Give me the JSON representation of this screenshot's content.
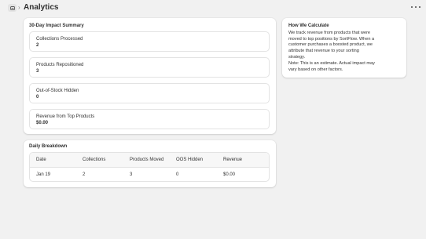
{
  "header": {
    "title": "Analytics",
    "breadcrumb_separator": "›",
    "app_icon": "app-icon",
    "more_icon": "more-horizontal-icon"
  },
  "summary": {
    "title": "30-Day Impact Summary",
    "metrics": [
      {
        "label": "Collections Processed",
        "value": "2"
      },
      {
        "label": "Products Repositioned",
        "value": "3"
      },
      {
        "label": "Out-of-Stock Hidden",
        "value": "0"
      },
      {
        "label": "Revenue from Top Products",
        "value": "$0.00"
      }
    ]
  },
  "how": {
    "title": "How We Calculate",
    "lines": [
      "We track revenue from products that were",
      "moved to top positions by SortFlow. When a",
      "customer purchases a boosted product, we",
      "attribute that revenue to your sorting",
      "strategy."
    ],
    "note_lines": [
      "Note: This is an estimate. Actual impact may",
      "vary based on other factors."
    ]
  },
  "breakdown": {
    "title": "Daily Breakdown",
    "columns": [
      "Date",
      "Collections",
      "Products Moved",
      "OOS Hidden",
      "Revenue"
    ],
    "rows": [
      [
        "Jan 19",
        "2",
        "3",
        "0",
        "$0.00"
      ]
    ]
  },
  "colors": {
    "background": "#f1f1f1",
    "card": "#ffffff",
    "border": "#e3e3e3",
    "text": "#303030"
  }
}
